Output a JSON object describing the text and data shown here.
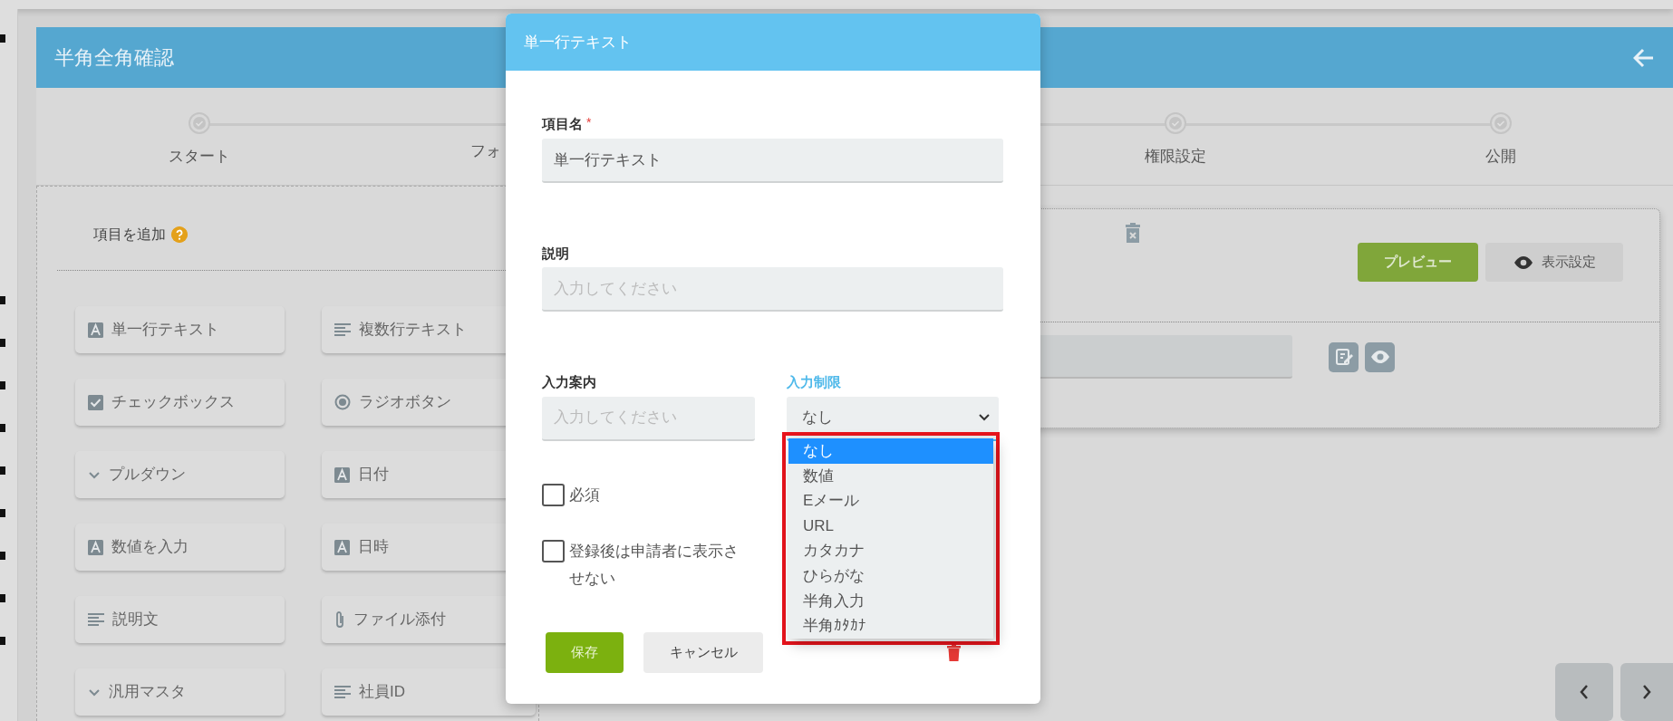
{
  "app_header": {
    "title": "半角全角確認"
  },
  "steps": [
    {
      "label": "スタート",
      "kind": "step"
    },
    {
      "label": "フォ",
      "kind": "cut"
    },
    {
      "label": "権限設定",
      "kind": "step"
    },
    {
      "label": "公開",
      "kind": "step"
    }
  ],
  "palette": {
    "title": "項目を追加",
    "items": [
      {
        "label": "単一行テキスト",
        "kind": "text"
      },
      {
        "label": "複数行テキスト",
        "kind": "lines"
      },
      {
        "label": "チェックボックス",
        "kind": "check"
      },
      {
        "label": "ラジオボタン",
        "kind": "radio"
      },
      {
        "label": "プルダウン",
        "kind": "chevron"
      },
      {
        "label": "日付",
        "kind": "text"
      },
      {
        "label": "数値を入力",
        "kind": "text"
      },
      {
        "label": "日時",
        "kind": "text"
      },
      {
        "label": "説明文",
        "kind": "lines"
      },
      {
        "label": "ファイル添付",
        "kind": "clip"
      },
      {
        "label": "汎用マスタ",
        "kind": "chevron"
      },
      {
        "label": "社員ID",
        "kind": "lines"
      }
    ]
  },
  "canvas": {
    "preview_button": "プレビュー",
    "display_button": "表示設定"
  },
  "modal": {
    "title": "単一行テキスト",
    "name_field": {
      "label": "項目名",
      "required_mark": "*",
      "value": "単一行テキスト"
    },
    "description_field": {
      "label": "説明",
      "placeholder": "入力してください"
    },
    "guide_field": {
      "label": "入力案内",
      "placeholder": "入力してください"
    },
    "restriction_field": {
      "label": "入力制限",
      "value": "なし",
      "focused": true
    },
    "checkboxes": [
      {
        "label": "必須",
        "checked": false
      },
      {
        "label": "登録後は申請者に表示させない",
        "checked": false
      }
    ],
    "save_button": "保存",
    "cancel_button": "キャンセル",
    "dropdown": {
      "highlighted": true,
      "options": [
        {
          "label": "なし",
          "selected": true
        },
        {
          "label": "数値",
          "selected": false
        },
        {
          "label": "Eメール",
          "selected": false
        },
        {
          "label": "URL",
          "selected": false
        },
        {
          "label": "カタカナ",
          "selected": false
        },
        {
          "label": "ひらがな",
          "selected": false
        },
        {
          "label": "半角入力",
          "selected": false
        },
        {
          "label": "半角ｶﾀｶﾅ",
          "selected": false
        }
      ]
    }
  }
}
